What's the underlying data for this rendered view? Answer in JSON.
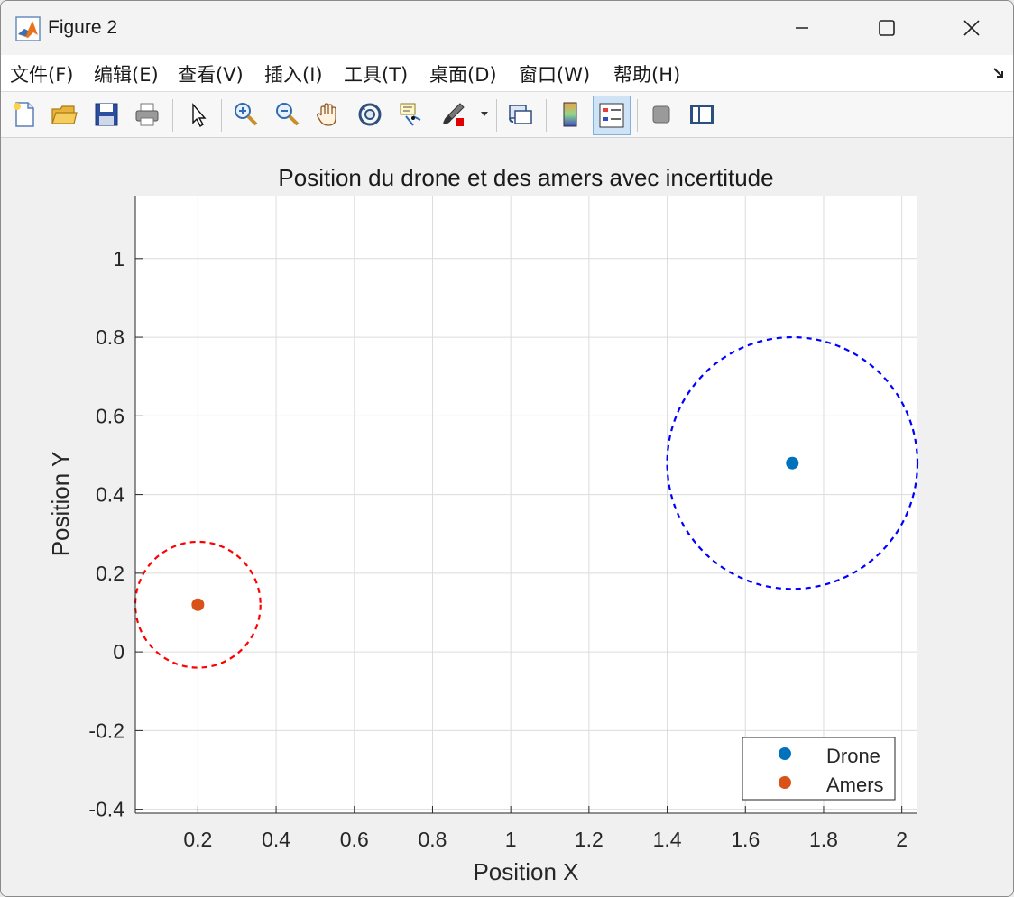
{
  "window": {
    "title": "Figure 2"
  },
  "menu": [
    "文件(F)",
    "编辑(E)",
    "查看(V)",
    "插入(I)",
    "工具(T)",
    "桌面(D)",
    "窗口(W)",
    "帮助(H)"
  ],
  "toolbar": [
    "new-figure-icon",
    "open-file-icon",
    "save-icon",
    "print-icon",
    "pointer-icon",
    "zoom-in-icon",
    "zoom-out-icon",
    "pan-icon",
    "rotate-3d-icon",
    "data-cursor-icon",
    "brush-icon",
    "link-plot-icon",
    "colorbar-icon",
    "legend-icon",
    "hide-plot-tools-icon",
    "show-plot-tools-icon"
  ],
  "chart_data": {
    "type": "scatter",
    "title": "Position du drone et des amers avec incertitude",
    "xlabel": "Position X",
    "ylabel": "Position Y",
    "xlim": [
      0.04,
      2.04
    ],
    "ylim": [
      -0.41,
      1.16
    ],
    "xticks": [
      0.2,
      0.4,
      0.6,
      0.8,
      1,
      1.2,
      1.4,
      1.6,
      1.8,
      2
    ],
    "yticks": [
      -0.4,
      -0.2,
      0,
      0.2,
      0.4,
      0.6,
      0.8,
      1
    ],
    "grid": true,
    "legend_position": "bottom-right",
    "series": [
      {
        "name": "Drone",
        "color": "#0072BD",
        "x": [
          1.72
        ],
        "y": [
          0.48
        ]
      },
      {
        "name": "Amers",
        "color": "#D95319",
        "x": [
          0.2
        ],
        "y": [
          0.12
        ]
      }
    ],
    "uncertainty_circles": [
      {
        "cx": 1.72,
        "cy": 0.48,
        "r": 0.32,
        "color": "#0000FF",
        "style": "dashed"
      },
      {
        "cx": 0.2,
        "cy": 0.12,
        "r": 0.16,
        "color": "#FF0000",
        "style": "dashed"
      }
    ]
  }
}
